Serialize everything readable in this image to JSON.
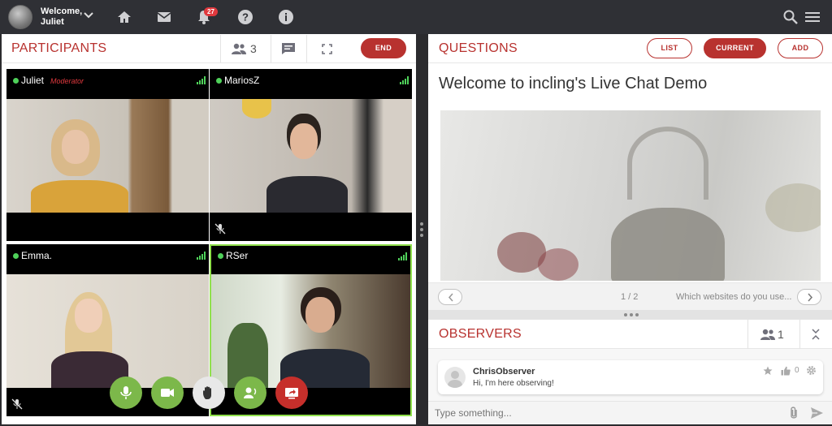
{
  "topbar": {
    "welcome_line1": "Welcome,",
    "welcome_line2": "Juliet",
    "notifications_count": "27"
  },
  "participants": {
    "title": "PARTICIPANTS",
    "count": "3",
    "end_label": "END",
    "tiles": [
      {
        "name": "Juliet",
        "role": "Moderator"
      },
      {
        "name": "MariosZ",
        "role": ""
      },
      {
        "name": "Emma.",
        "role": ""
      },
      {
        "name": "RSer",
        "role": ""
      }
    ]
  },
  "questions": {
    "title": "QUESTIONS",
    "list_label": "LIST",
    "current_label": "CURRENT",
    "add_label": "ADD",
    "heading": "Welcome to incling's Live Chat Demo",
    "pager": "1 / 2",
    "next_question": "Which websites do you use..."
  },
  "observers": {
    "title": "OBSERVERS",
    "count": "1",
    "messages": [
      {
        "author": "ChrisObserver",
        "text": "Hi, I'm here observing!",
        "likes": "0"
      }
    ],
    "input_placeholder": "Type something..."
  },
  "colors": {
    "accent": "#b8322f",
    "control_green": "#7cb84a",
    "control_red": "#c62f2b",
    "speaking_border": "#8fe04b"
  }
}
